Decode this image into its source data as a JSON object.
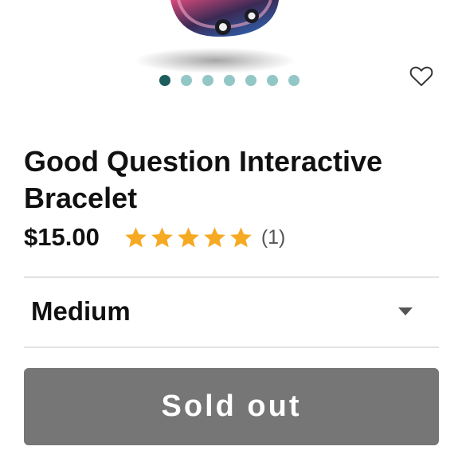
{
  "product": {
    "title": "Good Question Interactive Bracelet",
    "price": "$15.00",
    "rating_stars": 5,
    "rating_max": 5,
    "review_count": "(1)"
  },
  "gallery": {
    "slide_count": 7,
    "active_index": 0,
    "heart_icon": "heart-outline-icon"
  },
  "size_select": {
    "selected": "Medium",
    "chevron_icon": "chevron-down-icon"
  },
  "buy_button": {
    "label": "Sold out"
  },
  "colors": {
    "dot_active": "#1c5c5d",
    "dot_inactive": "#93c7c7",
    "star": "#f6a922",
    "button_bg": "#767676",
    "divider": "#e2e2e2"
  }
}
